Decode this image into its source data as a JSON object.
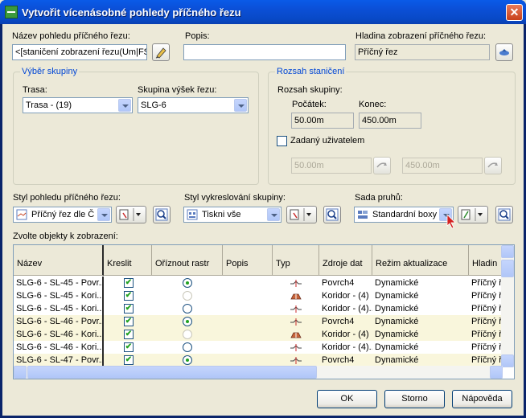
{
  "window": {
    "title": "Vytvořit vícenásobné pohledy příčného řezu",
    "close_label": "✕"
  },
  "name_field": {
    "label": "Název pohledu příčného řezu:",
    "value": "<[staničení zobrazení řezu(Um|FS|"
  },
  "description": {
    "label": "Popis:",
    "value": ""
  },
  "layer": {
    "label": "Hladina zobrazení příčného řezu:",
    "value": "Příčný řez"
  },
  "group_selection": {
    "title": "Výběr skupiny",
    "alignment_label": "Trasa:",
    "alignment_value": "Trasa - (19)",
    "sample_group_label": "Skupina výšek řezu:",
    "sample_group_value": "SLG-6"
  },
  "station_range": {
    "title": "Rozsah staničení",
    "group_range_label": "Rozsah skupiny:",
    "start_label": "Počátek:",
    "end_label": "Konec:",
    "start_value": "50.00m",
    "end_value": "450.00m",
    "user_label": "Zadaný uživatelem",
    "user_start": "50.00m",
    "user_end": "450.00m"
  },
  "view_style": {
    "label": "Styl pohledu  příčného řezu:",
    "value": "Příčný řez dle Č"
  },
  "plot_style": {
    "label": "Styl vykreslování skupiny:",
    "value": "Tiskni vše"
  },
  "band_set": {
    "label": "Sada pruhů:",
    "value": "Standardní boxy"
  },
  "objects": {
    "label": "Zvolte objekty k zobrazení:",
    "columns": [
      "Název",
      "Kreslit",
      "Oříznout rastr",
      "Popis",
      "Typ",
      "Zdroje dat",
      "Režim aktualizace",
      "Hladin"
    ],
    "rows": [
      {
        "name": "SLG-6 - SL-45 - Povr...",
        "draw": true,
        "clip": "on",
        "desc": "",
        "type": "surface",
        "source": "Povrch4",
        "mode": "Dynamické",
        "layer": "Příčný ř"
      },
      {
        "name": "SLG-6 - SL-45 - Kori...",
        "draw": true,
        "clip": "dim",
        "desc": "",
        "type": "corridor",
        "source": "Koridor - (4)",
        "mode": "Dynamické",
        "layer": "Příčný ř"
      },
      {
        "name": "SLG-6 - SL-45 - Kori...",
        "draw": true,
        "clip": "off",
        "desc": "",
        "type": "surface",
        "source": "Koridor - (4)...",
        "mode": "Dynamické",
        "layer": "Příčný ř"
      },
      {
        "name": "SLG-6 - SL-46 - Povr...",
        "draw": true,
        "clip": "on",
        "desc": "",
        "type": "surface",
        "source": "Povrch4",
        "mode": "Dynamické",
        "layer": "Příčný ř"
      },
      {
        "name": "SLG-6 - SL-46 - Kori...",
        "draw": true,
        "clip": "dim",
        "desc": "",
        "type": "corridor",
        "source": "Koridor - (4)",
        "mode": "Dynamické",
        "layer": "Příčný ř"
      },
      {
        "name": "SLG-6 - SL-46 - Kori...",
        "draw": true,
        "clip": "off",
        "desc": "",
        "type": "surface",
        "source": "Koridor - (4)...",
        "mode": "Dynamické",
        "layer": "Příčný ř"
      },
      {
        "name": "SLG-6 - SL-47 - Povr...",
        "draw": true,
        "clip": "on",
        "desc": "",
        "type": "surface",
        "source": "Povrch4",
        "mode": "Dynamické",
        "layer": "Příčný ř"
      }
    ]
  },
  "buttons": {
    "ok": "OK",
    "cancel": "Storno",
    "help": "Nápověda"
  }
}
